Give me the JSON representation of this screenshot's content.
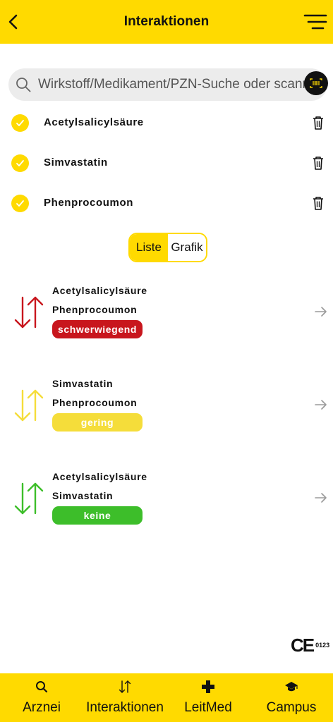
{
  "header": {
    "title": "Interaktionen"
  },
  "search": {
    "placeholder": "Wirkstoff/Medikament/PZN-Suche oder scannen"
  },
  "medications": [
    {
      "name": "Acetylsalicylsäure"
    },
    {
      "name": "Simvastatin"
    },
    {
      "name": "Phenprocoumon"
    }
  ],
  "view_toggle": {
    "list_label": "Liste",
    "graph_label": "Grafik",
    "selected": "Liste"
  },
  "interactions": [
    {
      "drug_a": "Acetylsalicylsäure",
      "drug_b": "Phenprocoumon",
      "severity": "schwerwiegend",
      "color": "#C8161D"
    },
    {
      "drug_a": "Simvastatin",
      "drug_b": "Phenprocoumon",
      "severity": "gering",
      "color": "#F5DD3A"
    },
    {
      "drug_a": "Acetylsalicylsäure",
      "drug_b": "Simvastatin",
      "severity": "keine",
      "color": "#3DBE2A"
    }
  ],
  "certification": {
    "mark": "CE",
    "number": "0123"
  },
  "tabbar": {
    "items": [
      {
        "label": "Arznei",
        "icon": "search-icon"
      },
      {
        "label": "Interaktionen",
        "icon": "interaction-arrows-icon"
      },
      {
        "label": "LeitMed",
        "icon": "medical-cross-icon"
      },
      {
        "label": "Campus",
        "icon": "graduation-cap-icon"
      }
    ]
  },
  "colors": {
    "accent": "#FFDA00",
    "text": "#111111",
    "search_bg": "#ECECEC"
  }
}
